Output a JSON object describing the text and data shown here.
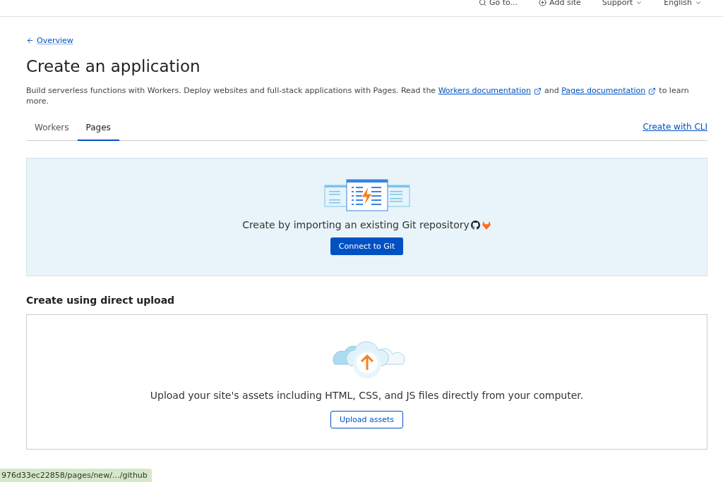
{
  "top_bar": {
    "items": [
      {
        "kind": "search",
        "label": "Go to..."
      },
      {
        "kind": "add",
        "label": "Add site"
      },
      {
        "kind": "menu",
        "label": "Support"
      },
      {
        "kind": "menu",
        "label": "English"
      }
    ]
  },
  "back_link": "Overview",
  "title": "Create an application",
  "description": {
    "before": "Build serverless functions with Workers. Deploy websites and full-stack applications with Pages. Read the",
    "link_1": "Workers documentation",
    "between": "and",
    "link_2": "Pages documentation",
    "after": "to learn more."
  },
  "tabs": [
    {
      "label": "Workers",
      "selected": false
    },
    {
      "label": "Pages",
      "selected": true
    }
  ],
  "cli_link": "Create with CLI",
  "git_panel": {
    "text": "Create by importing an existing Git repository",
    "button": "Connect to Git"
  },
  "upload_section": {
    "heading": "Create using direct upload",
    "text": "Upload your site's assets including HTML, CSS, and JS files directly from your computer.",
    "button": "Upload assets"
  },
  "status_bar": "976d33ec22858/pages/new/…/github"
}
